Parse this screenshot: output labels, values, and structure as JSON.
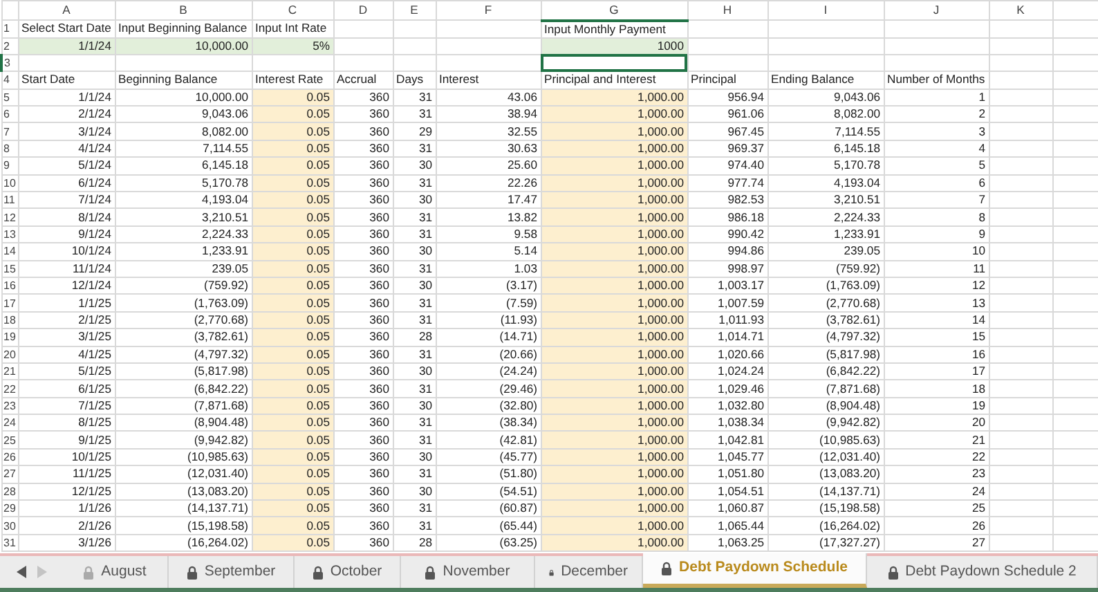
{
  "sheet": {
    "columns": [
      "A",
      "B",
      "C",
      "D",
      "E",
      "F",
      "G",
      "H",
      "I",
      "J",
      "K"
    ],
    "rows": [
      {
        "number": "1",
        "kind": "input_labels",
        "cells": [
          {
            "text": "Select Start Date",
            "selected": false
          },
          {
            "text": "Input Beginning Balance",
            "selected": false
          },
          {
            "text": "Input Int Rate",
            "selected": false
          },
          null,
          null,
          null,
          {
            "text": "Input Monthly Payment",
            "selected": false
          }
        ]
      },
      {
        "number": "2",
        "kind": "inputs",
        "cells": [
          {
            "text": "1/1/24",
            "selected": false
          },
          {
            "text": "10,000.00",
            "selected": false
          },
          {
            "text": "5%",
            "selected": false
          },
          null,
          null,
          null,
          {
            "text": "1000",
            "selected": false
          }
        ]
      },
      {
        "number": "3",
        "kind": "blank",
        "cells": [
          null,
          null,
          null,
          null,
          null,
          null,
          {
            "selected": true
          }
        ]
      },
      {
        "number": "4",
        "kind": "header",
        "cells": [
          "Start Date",
          "Beginning Balance",
          "Interest Rate",
          "Accrual",
          "Days",
          "Interest",
          "Principal and Interest",
          "Principal",
          "Ending Balance",
          "Number of Months"
        ]
      },
      {
        "number": "5",
        "kind": "data",
        "cells": [
          "1/1/24",
          "10,000.00",
          "0.05",
          "360",
          "31",
          "43.06",
          "1,000.00",
          "956.94",
          "9,043.06",
          "1"
        ]
      },
      {
        "number": "6",
        "kind": "data",
        "cells": [
          "2/1/24",
          "9,043.06",
          "0.05",
          "360",
          "31",
          "38.94",
          "1,000.00",
          "961.06",
          "8,082.00",
          "2"
        ]
      },
      {
        "number": "7",
        "kind": "data",
        "cells": [
          "3/1/24",
          "8,082.00",
          "0.05",
          "360",
          "29",
          "32.55",
          "1,000.00",
          "967.45",
          "7,114.55",
          "3"
        ]
      },
      {
        "number": "8",
        "kind": "data",
        "cells": [
          "4/1/24",
          "7,114.55",
          "0.05",
          "360",
          "31",
          "30.63",
          "1,000.00",
          "969.37",
          "6,145.18",
          "4"
        ]
      },
      {
        "number": "9",
        "kind": "data",
        "cells": [
          "5/1/24",
          "6,145.18",
          "0.05",
          "360",
          "30",
          "25.60",
          "1,000.00",
          "974.40",
          "5,170.78",
          "5"
        ]
      },
      {
        "number": "10",
        "kind": "data",
        "cells": [
          "6/1/24",
          "5,170.78",
          "0.05",
          "360",
          "31",
          "22.26",
          "1,000.00",
          "977.74",
          "4,193.04",
          "6"
        ]
      },
      {
        "number": "11",
        "kind": "data",
        "cells": [
          "7/1/24",
          "4,193.04",
          "0.05",
          "360",
          "30",
          "17.47",
          "1,000.00",
          "982.53",
          "3,210.51",
          "7"
        ]
      },
      {
        "number": "12",
        "kind": "data",
        "cells": [
          "8/1/24",
          "3,210.51",
          "0.05",
          "360",
          "31",
          "13.82",
          "1,000.00",
          "986.18",
          "2,224.33",
          "8"
        ]
      },
      {
        "number": "13",
        "kind": "data",
        "cells": [
          "9/1/24",
          "2,224.33",
          "0.05",
          "360",
          "31",
          "9.58",
          "1,000.00",
          "990.42",
          "1,233.91",
          "9"
        ]
      },
      {
        "number": "14",
        "kind": "data",
        "cells": [
          "10/1/24",
          "1,233.91",
          "0.05",
          "360",
          "30",
          "5.14",
          "1,000.00",
          "994.86",
          "239.05",
          "10"
        ]
      },
      {
        "number": "15",
        "kind": "data",
        "cells": [
          "11/1/24",
          "239.05",
          "0.05",
          "360",
          "31",
          "1.03",
          "1,000.00",
          "998.97",
          "(759.92)",
          "11"
        ]
      },
      {
        "number": "16",
        "kind": "data",
        "cells": [
          "12/1/24",
          "(759.92)",
          "0.05",
          "360",
          "30",
          "(3.17)",
          "1,000.00",
          "1,003.17",
          "(1,763.09)",
          "12"
        ]
      },
      {
        "number": "17",
        "kind": "data",
        "cells": [
          "1/1/25",
          "(1,763.09)",
          "0.05",
          "360",
          "31",
          "(7.59)",
          "1,000.00",
          "1,007.59",
          "(2,770.68)",
          "13"
        ]
      },
      {
        "number": "18",
        "kind": "data",
        "cells": [
          "2/1/25",
          "(2,770.68)",
          "0.05",
          "360",
          "31",
          "(11.93)",
          "1,000.00",
          "1,011.93",
          "(3,782.61)",
          "14"
        ]
      },
      {
        "number": "19",
        "kind": "data",
        "cells": [
          "3/1/25",
          "(3,782.61)",
          "0.05",
          "360",
          "28",
          "(14.71)",
          "1,000.00",
          "1,014.71",
          "(4,797.32)",
          "15"
        ]
      },
      {
        "number": "20",
        "kind": "data",
        "cells": [
          "4/1/25",
          "(4,797.32)",
          "0.05",
          "360",
          "31",
          "(20.66)",
          "1,000.00",
          "1,020.66",
          "(5,817.98)",
          "16"
        ]
      },
      {
        "number": "21",
        "kind": "data",
        "cells": [
          "5/1/25",
          "(5,817.98)",
          "0.05",
          "360",
          "30",
          "(24.24)",
          "1,000.00",
          "1,024.24",
          "(6,842.22)",
          "17"
        ]
      },
      {
        "number": "22",
        "kind": "data",
        "cells": [
          "6/1/25",
          "(6,842.22)",
          "0.05",
          "360",
          "31",
          "(29.46)",
          "1,000.00",
          "1,029.46",
          "(7,871.68)",
          "18"
        ]
      },
      {
        "number": "23",
        "kind": "data",
        "cells": [
          "7/1/25",
          "(7,871.68)",
          "0.05",
          "360",
          "30",
          "(32.80)",
          "1,000.00",
          "1,032.80",
          "(8,904.48)",
          "19"
        ]
      },
      {
        "number": "24",
        "kind": "data",
        "cells": [
          "8/1/25",
          "(8,904.48)",
          "0.05",
          "360",
          "31",
          "(38.34)",
          "1,000.00",
          "1,038.34",
          "(9,942.82)",
          "20"
        ]
      },
      {
        "number": "25",
        "kind": "data",
        "cells": [
          "9/1/25",
          "(9,942.82)",
          "0.05",
          "360",
          "31",
          "(42.81)",
          "1,000.00",
          "1,042.81",
          "(10,985.63)",
          "21"
        ]
      },
      {
        "number": "26",
        "kind": "data",
        "cells": [
          "10/1/25",
          "(10,985.63)",
          "0.05",
          "360",
          "30",
          "(45.77)",
          "1,000.00",
          "1,045.77",
          "(12,031.40)",
          "22"
        ]
      },
      {
        "number": "27",
        "kind": "data",
        "cells": [
          "11/1/25",
          "(12,031.40)",
          "0.05",
          "360",
          "31",
          "(51.80)",
          "1,000.00",
          "1,051.80",
          "(13,083.20)",
          "23"
        ]
      },
      {
        "number": "28",
        "kind": "data",
        "cells": [
          "12/1/25",
          "(13,083.20)",
          "0.05",
          "360",
          "30",
          "(54.51)",
          "1,000.00",
          "1,054.51",
          "(14,137.71)",
          "24"
        ]
      },
      {
        "number": "29",
        "kind": "data",
        "cells": [
          "1/1/26",
          "(14,137.71)",
          "0.05",
          "360",
          "31",
          "(60.87)",
          "1,000.00",
          "1,060.87",
          "(15,198.58)",
          "25"
        ]
      },
      {
        "number": "30",
        "kind": "data",
        "cells": [
          "2/1/26",
          "(15,198.58)",
          "0.05",
          "360",
          "31",
          "(65.44)",
          "1,000.00",
          "1,065.44",
          "(16,264.02)",
          "26"
        ]
      },
      {
        "number": "31",
        "kind": "data",
        "cells": [
          "3/1/26",
          "(16,264.02)",
          "0.05",
          "360",
          "28",
          "(63.25)",
          "1,000.00",
          "1,063.25",
          "(17,327.27)",
          "27"
        ]
      }
    ]
  },
  "sheet_nav": {
    "back_disabled": false,
    "forward_disabled": true
  },
  "tabs": [
    {
      "label": "August",
      "locked": true,
      "selected": false
    },
    {
      "label": "September",
      "locked": true,
      "selected": false
    },
    {
      "label": "October",
      "locked": true,
      "selected": false
    },
    {
      "label": "November",
      "locked": true,
      "selected": false
    },
    {
      "label": "December",
      "locked": true,
      "selected": false
    },
    {
      "label": "Debt Paydown Schedule",
      "locked": true,
      "selected": true
    },
    {
      "label": "Debt Paydown Schedule 2",
      "locked": true,
      "selected": false
    }
  ]
}
